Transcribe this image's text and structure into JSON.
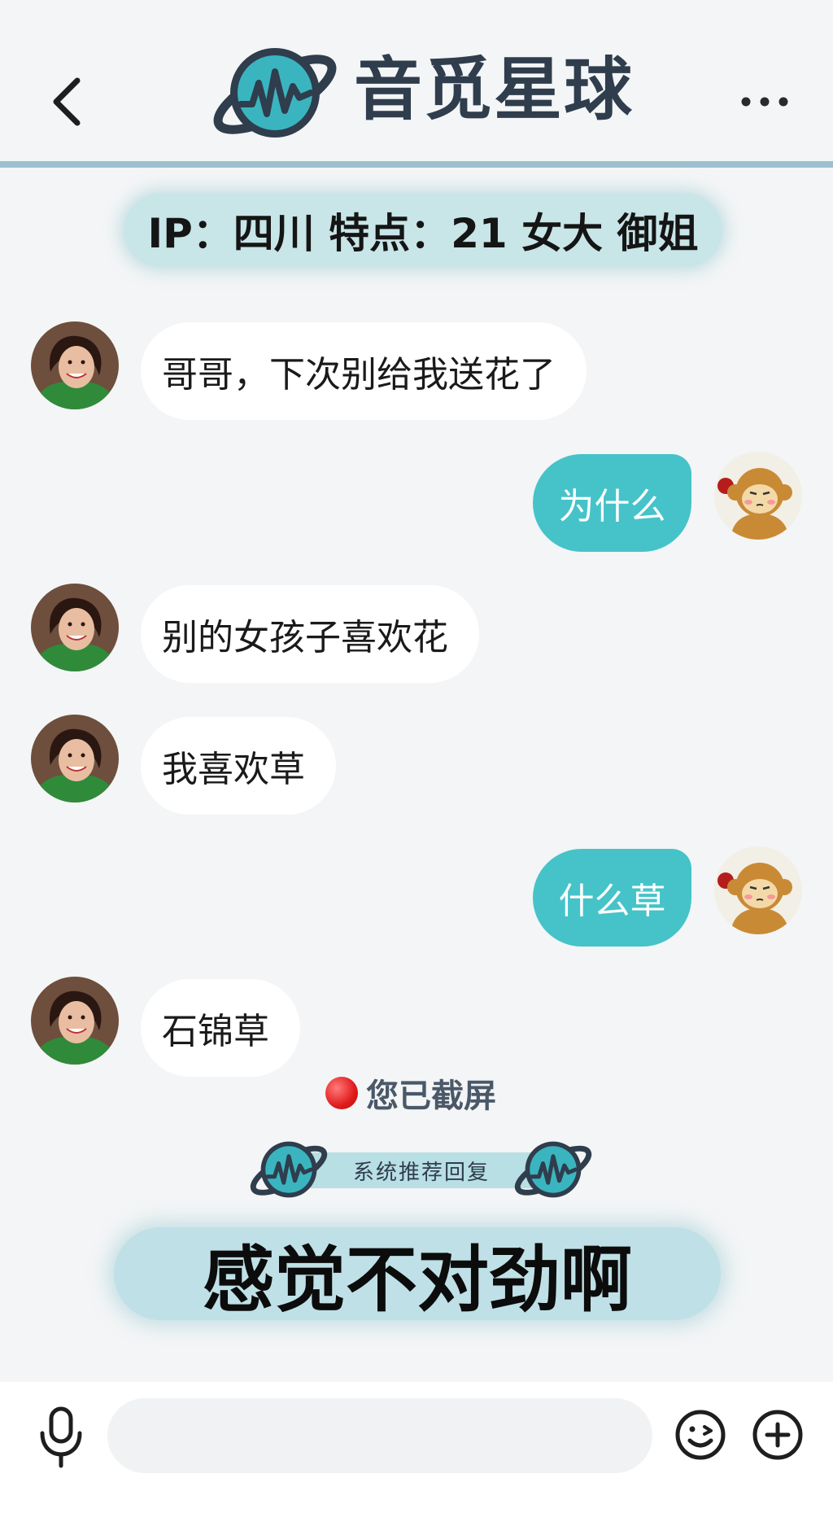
{
  "header": {
    "back_icon": "chevron-left-icon",
    "title": "音觅星球",
    "more_icon": "more-horizontal-icon",
    "logo_icon": "planet-soundwave-logo"
  },
  "profile_info": "IP：四川 特点：21 女大 御姐",
  "messages": [
    {
      "side": "left",
      "text": "哥哥，下次别给我送花了"
    },
    {
      "side": "right",
      "text": "为什么"
    },
    {
      "side": "left",
      "text": "别的女孩子喜欢花"
    },
    {
      "side": "left",
      "text": "我喜欢草"
    },
    {
      "side": "right",
      "text": "什么草"
    },
    {
      "side": "left",
      "text": "石锦草"
    }
  ],
  "screenshot_notice": "您已截屏",
  "recommend": {
    "label": "系统推荐回复",
    "suggestion": "感觉不对劲啊"
  },
  "input_bar": {
    "mic_icon": "microphone-icon",
    "placeholder": "",
    "emoji_icon": "emoji-icon",
    "plus_icon": "plus-circle-icon"
  },
  "colors": {
    "accent": "#45c3c9",
    "pill": "#c8e5e8",
    "header_line": "#9dbfcf",
    "background": "#f3f5f6"
  }
}
